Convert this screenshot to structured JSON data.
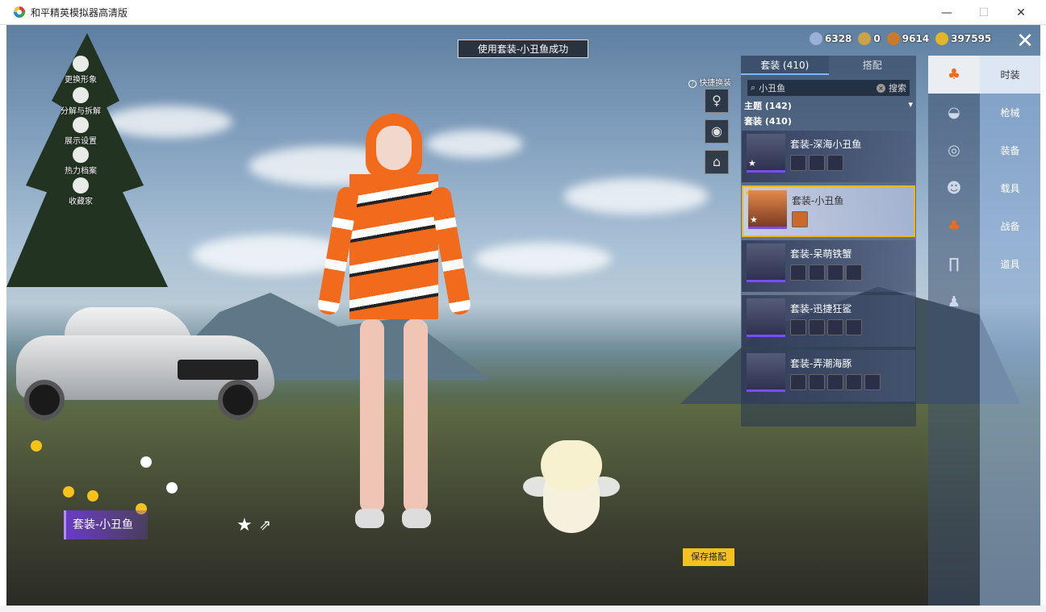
{
  "window": {
    "title": "和平精英模拟器高清版",
    "min": "—",
    "max": "☐",
    "close": "✕"
  },
  "toast": "使用套装-小丑鱼成功",
  "currency": [
    {
      "icon": "globe-coin-icon",
      "value": "6328",
      "color": "#9bb0d6"
    },
    {
      "icon": "medal-coin-icon",
      "value": "0",
      "color": "#c9a24a"
    },
    {
      "icon": "bronze-coin-icon",
      "value": "9614",
      "color": "#c97a2a"
    },
    {
      "icon": "gold-coin-icon",
      "value": "397595",
      "color": "#e3b52b"
    }
  ],
  "left_menu": [
    {
      "label": "更换形象",
      "icon": "person-icon"
    },
    {
      "label": "分解与拆解",
      "icon": "puzzle-icon"
    },
    {
      "label": "展示设置",
      "icon": "eye-icon"
    },
    {
      "label": "热力档案",
      "icon": "flame-icon"
    },
    {
      "label": "收藏家",
      "icon": "crown-icon"
    }
  ],
  "quick_change": {
    "label": "快捷换装",
    "help": "?"
  },
  "panel": {
    "tabs": [
      "套装 (410)",
      "搭配"
    ],
    "search": {
      "value": "小丑鱼",
      "button": "搜索"
    },
    "theme": "主题 (142)",
    "set_count": "套装 (410)",
    "items": [
      {
        "name": "套装-深海小丑鱼",
        "subs": 3,
        "selected": false
      },
      {
        "name": "套装-小丑鱼",
        "subs": 1,
        "selected": true
      },
      {
        "name": "套装-呆萌铁蟹",
        "subs": 4,
        "selected": false
      },
      {
        "name": "套装-迅捷狂鲨",
        "subs": 4,
        "selected": false
      },
      {
        "name": "套装-弄潮海豚",
        "subs": 5,
        "selected": false
      }
    ]
  },
  "category_icons": [
    "outfit-icon",
    "cap-icon",
    "glasses-icon",
    "face-icon",
    "top-icon",
    "pants-icon",
    "shoes-icon"
  ],
  "right_tabs": [
    "时装",
    "枪械",
    "装备",
    "载具",
    "战备",
    "道具"
  ],
  "outfit_label": "套装-小丑鱼",
  "save_button": "保存搭配",
  "colors": {
    "accent": "#f4c21e",
    "clownfish": "#f26a1b",
    "purple": "#6a3cc4"
  }
}
